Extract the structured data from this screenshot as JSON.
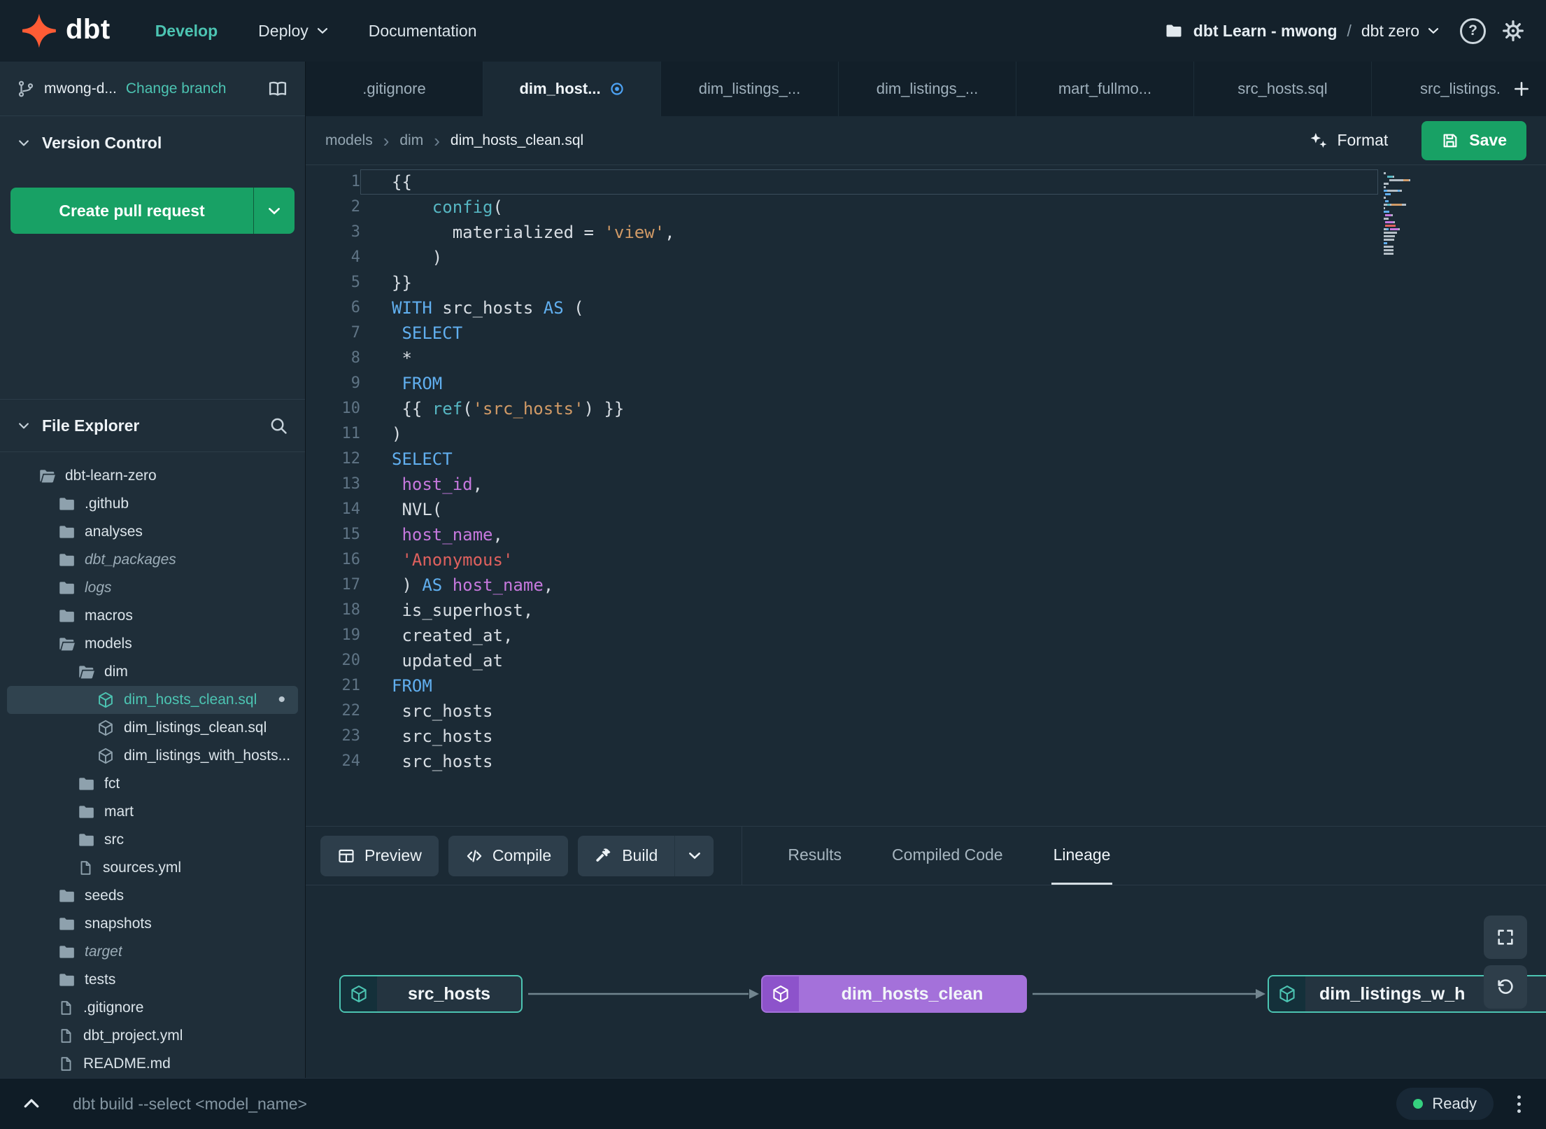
{
  "navbar": {
    "logo_text": "dbt",
    "nav": {
      "develop": "Develop",
      "deploy": "Deploy",
      "documentation": "Documentation"
    },
    "project_name": "dbt Learn - mwong",
    "path_separator": "/",
    "environment": "dbt zero"
  },
  "sidebar": {
    "branch_name": "mwong-d...",
    "change_branch_label": "Change branch",
    "version_control_label": "Version Control",
    "create_pr_label": "Create pull request",
    "file_explorer_label": "File Explorer",
    "tree": [
      {
        "label": "dbt-learn-zero",
        "icon": "folderOpen",
        "level": 0
      },
      {
        "label": ".github",
        "icon": "folder",
        "level": 1
      },
      {
        "label": "analyses",
        "icon": "folder",
        "level": 1
      },
      {
        "label": "dbt_packages",
        "icon": "folder",
        "level": 1,
        "italic": true
      },
      {
        "label": "logs",
        "icon": "folder",
        "level": 1,
        "italic": true
      },
      {
        "label": "macros",
        "icon": "folder",
        "level": 1
      },
      {
        "label": "models",
        "icon": "folderOpen",
        "level": 1
      },
      {
        "label": "dim",
        "icon": "folderOpen",
        "level": 2
      },
      {
        "label": "dim_hosts_clean.sql",
        "icon": "model",
        "level": 3,
        "selected": true,
        "dot": true
      },
      {
        "label": "dim_listings_clean.sql",
        "icon": "model",
        "level": 3
      },
      {
        "label": "dim_listings_with_hosts...",
        "icon": "model",
        "level": 3
      },
      {
        "label": "fct",
        "icon": "folder",
        "level": 2
      },
      {
        "label": "mart",
        "icon": "folder",
        "level": 2
      },
      {
        "label": "src",
        "icon": "folder",
        "level": 2
      },
      {
        "label": "sources.yml",
        "icon": "file",
        "level": 2
      },
      {
        "label": "seeds",
        "icon": "folder",
        "level": 1
      },
      {
        "label": "snapshots",
        "icon": "folder",
        "level": 1
      },
      {
        "label": "target",
        "icon": "folder",
        "level": 1,
        "italic": true
      },
      {
        "label": "tests",
        "icon": "folder",
        "level": 1
      },
      {
        "label": ".gitignore",
        "icon": "file",
        "level": 1
      },
      {
        "label": "dbt_project.yml",
        "icon": "file",
        "level": 1
      },
      {
        "label": "README.md",
        "icon": "file",
        "level": 1
      }
    ]
  },
  "editor_tabs": [
    {
      "label": ".gitignore"
    },
    {
      "label": "dim_host...",
      "active": true,
      "modified": true
    },
    {
      "label": "dim_listings_..."
    },
    {
      "label": "dim_listings_..."
    },
    {
      "label": "mart_fullmo..."
    },
    {
      "label": "src_hosts.sql"
    },
    {
      "label": "src_listings."
    }
  ],
  "breadcrumb": {
    "items": [
      "models",
      "dim",
      "dim_hosts_clean.sql"
    ]
  },
  "actions": {
    "format_label": "Format",
    "save_label": "Save"
  },
  "editor": {
    "lines": [
      {
        "n": 1,
        "t": [
          [
            "{{",
            "p"
          ]
        ]
      },
      {
        "n": 2,
        "t": [
          [
            "    ",
            "p"
          ],
          [
            "config",
            "f"
          ],
          [
            "(",
            "p"
          ]
        ]
      },
      {
        "n": 3,
        "t": [
          [
            "      ",
            "p"
          ],
          [
            "materialized",
            "p"
          ],
          [
            " = ",
            "p"
          ],
          [
            "'view'",
            "s"
          ],
          [
            ",",
            "p"
          ]
        ]
      },
      {
        "n": 4,
        "t": [
          [
            "    )",
            "p"
          ]
        ]
      },
      {
        "n": 5,
        "t": [
          [
            "}}",
            "p"
          ]
        ]
      },
      {
        "n": 6,
        "t": [
          [
            "WITH",
            "k"
          ],
          [
            " src_hosts ",
            "p"
          ],
          [
            "AS",
            "k"
          ],
          [
            " (",
            "p"
          ]
        ]
      },
      {
        "n": 7,
        "t": [
          [
            " ",
            "p"
          ],
          [
            "SELECT",
            "k"
          ]
        ]
      },
      {
        "n": 8,
        "t": [
          [
            " *",
            "p"
          ]
        ]
      },
      {
        "n": 9,
        "t": [
          [
            " ",
            "p"
          ],
          [
            "FROM",
            "k"
          ]
        ]
      },
      {
        "n": 10,
        "t": [
          [
            " {{ ",
            "p"
          ],
          [
            "ref",
            "f"
          ],
          [
            "(",
            "p"
          ],
          [
            "'src_hosts'",
            "s"
          ],
          [
            ") }}",
            "p"
          ]
        ]
      },
      {
        "n": 11,
        "t": [
          [
            ")",
            "p"
          ]
        ]
      },
      {
        "n": 12,
        "t": [
          [
            "SELECT",
            "k"
          ]
        ]
      },
      {
        "n": 13,
        "t": [
          [
            " ",
            "p"
          ],
          [
            "host_id",
            "m"
          ],
          [
            ",",
            "p"
          ]
        ]
      },
      {
        "n": 14,
        "t": [
          [
            " NVL(",
            "p"
          ]
        ]
      },
      {
        "n": 15,
        "t": [
          [
            " ",
            "p"
          ],
          [
            "host_name",
            "m"
          ],
          [
            ",",
            "p"
          ]
        ]
      },
      {
        "n": 16,
        "t": [
          [
            " ",
            "p"
          ],
          [
            "'Anonymous'",
            "r"
          ]
        ]
      },
      {
        "n": 17,
        "t": [
          [
            " ) ",
            "p"
          ],
          [
            "AS",
            "k"
          ],
          [
            " ",
            "p"
          ],
          [
            "host_name",
            "m"
          ],
          [
            ",",
            "p"
          ]
        ]
      },
      {
        "n": 18,
        "t": [
          [
            " is_superhost,",
            "p"
          ]
        ]
      },
      {
        "n": 19,
        "t": [
          [
            " created_at,",
            "p"
          ]
        ]
      },
      {
        "n": 20,
        "t": [
          [
            " updated_at",
            "p"
          ]
        ]
      },
      {
        "n": 21,
        "t": [
          [
            "FROM",
            "k"
          ]
        ]
      },
      {
        "n": 22,
        "t": [
          [
            " src_hosts",
            "p"
          ]
        ]
      },
      {
        "n": 23,
        "t": [
          [
            " src_hosts",
            "p"
          ]
        ]
      },
      {
        "n": 24,
        "t": [
          [
            " src_hosts",
            "p"
          ]
        ]
      }
    ]
  },
  "bottom_bar": {
    "preview_label": "Preview",
    "compile_label": "Compile",
    "build_label": "Build",
    "tabs": [
      {
        "label": "Results"
      },
      {
        "label": "Compiled Code"
      },
      {
        "label": "Lineage",
        "active": true
      }
    ]
  },
  "lineage": {
    "nodes": [
      {
        "label": "src_hosts",
        "style": "teal"
      },
      {
        "label": "dim_hosts_clean",
        "style": "purple"
      },
      {
        "label": "dim_listings_w_h",
        "style": "teal"
      }
    ]
  },
  "status_bar": {
    "command": "dbt build --select <model_name>",
    "status_label": "Ready"
  },
  "colors": {
    "accent_teal": "#4cc4b2",
    "button_green": "#18a165",
    "dbt_orange": "#ff5c35",
    "purple_node": "#a471da",
    "status_green": "#35d07f"
  }
}
